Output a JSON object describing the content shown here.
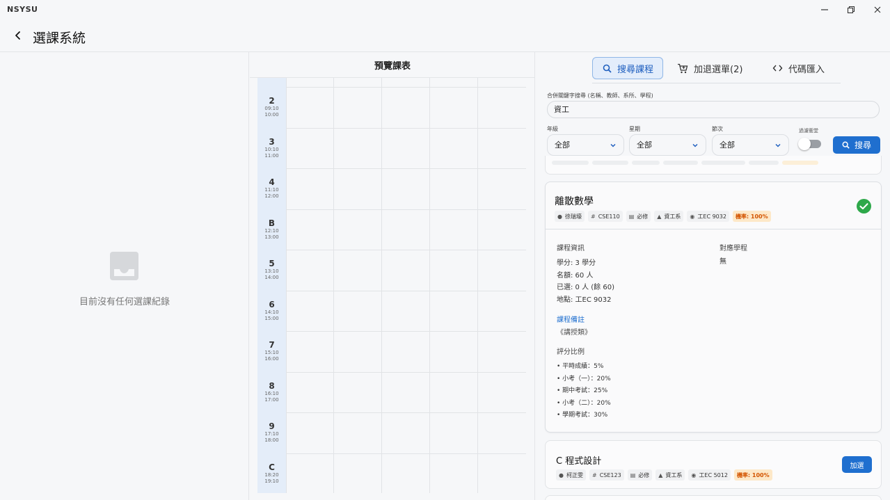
{
  "app": {
    "name": "NSYSU",
    "window_controls": [
      "minimize",
      "restore",
      "close"
    ]
  },
  "header": {
    "title": "選課系統",
    "back_icon": "back-arrow-icon"
  },
  "history": {
    "empty_text": "目前沒有任何選課紀錄",
    "icon": "inbox-icon"
  },
  "timetable": {
    "title": "預覽課表",
    "periods": [
      {
        "code": "2",
        "start": "09:10",
        "end": "10:00"
      },
      {
        "code": "3",
        "start": "10:10",
        "end": "11:00"
      },
      {
        "code": "4",
        "start": "11:10",
        "end": "12:00"
      },
      {
        "code": "B",
        "start": "12:10",
        "end": "13:00"
      },
      {
        "code": "5",
        "start": "13:10",
        "end": "14:00"
      },
      {
        "code": "6",
        "start": "14:10",
        "end": "15:00"
      },
      {
        "code": "7",
        "start": "15:10",
        "end": "16:00"
      },
      {
        "code": "8",
        "start": "16:10",
        "end": "17:00"
      },
      {
        "code": "9",
        "start": "17:10",
        "end": "18:00"
      },
      {
        "code": "C",
        "start": "18:20",
        "end": "19:10"
      }
    ]
  },
  "tabs": {
    "search": "搜尋課程",
    "cart": "加退選單(2)",
    "code": "代碼匯入"
  },
  "search": {
    "keyword_label": "合併關鍵字搜尋 (名稱、教師、系所、學程)",
    "keyword_value": "資工",
    "grade_label": "年級",
    "grade_value": "全部",
    "weekday_label": "星期",
    "weekday_value": "全部",
    "period_label": "節次",
    "period_value": "全部",
    "conflict_label": "過濾衝堂",
    "conflict_enabled": false,
    "button": "搜尋"
  },
  "courses": [
    {
      "name": "離散數學",
      "teacher": "徐瑞壕",
      "code": "CSE110",
      "type": "必修",
      "dept": "資工系",
      "room": "工EC 9032",
      "rate": "機率: 100%",
      "selected": true,
      "info_heading": "課程資訊",
      "program_heading": "對應學程",
      "program_value": "無",
      "credits": "學分: 3 學分",
      "quota": "名額: 60 人",
      "enrolled": "已選: 0 人 (餘 60)",
      "location": "地點: 工EC 9032",
      "note_heading": "課程備註",
      "note": "《講授類》",
      "grading_heading": "評分比例",
      "grading": [
        "• 平時成績：5%",
        "• 小考（一）：20%",
        "• 期中考試：25%",
        "• 小考（二）：20%",
        "• 學期考試：30%"
      ]
    },
    {
      "name": "C 程式設計",
      "teacher": "柯正雯",
      "code": "CSE123",
      "type": "必修",
      "dept": "資工系",
      "room": "工EC 5012",
      "rate": "機率: 100%",
      "action": "加選"
    }
  ],
  "colors": {
    "primary": "#1f6fcf",
    "success": "#2ea84a",
    "rate_bg": "#fde8c8",
    "rate_text": "#d35400",
    "timetable_col": "#e4edf9"
  }
}
